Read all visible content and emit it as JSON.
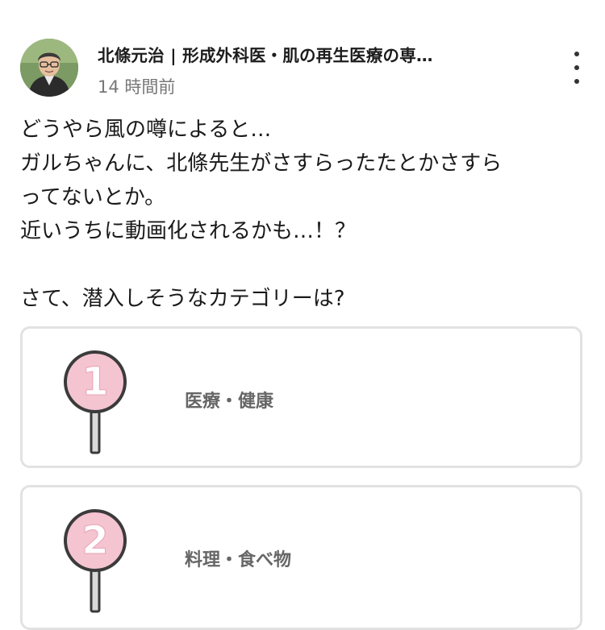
{
  "post": {
    "author": {
      "name": "北條元治 | 形成外科医・肌の再生医療の専…",
      "avatar": "avatar-photo"
    },
    "timestamp": "14 時間前",
    "more_icon": "more-vert-icon",
    "body_lines": [
      "どうやら風の噂によると…",
      "ガルちゃんに、北條先生がさすらったたとかさすら",
      "ってないとか。",
      "近いうちに動画化されるかも…！？",
      "",
      "さて、潜入しそうなカテゴリーは?"
    ]
  },
  "poll": {
    "options": [
      {
        "number": "1",
        "label": "医療・健康",
        "icon": "number-sign-icon"
      },
      {
        "number": "2",
        "label": "料理・食べ物",
        "icon": "number-sign-icon"
      }
    ]
  },
  "colors": {
    "sign_fill": "#f5c4d1",
    "sign_outline": "#3b3b3b",
    "option_border": "#e2e2e2",
    "label_text": "#666666",
    "timestamp_text": "#777777"
  }
}
